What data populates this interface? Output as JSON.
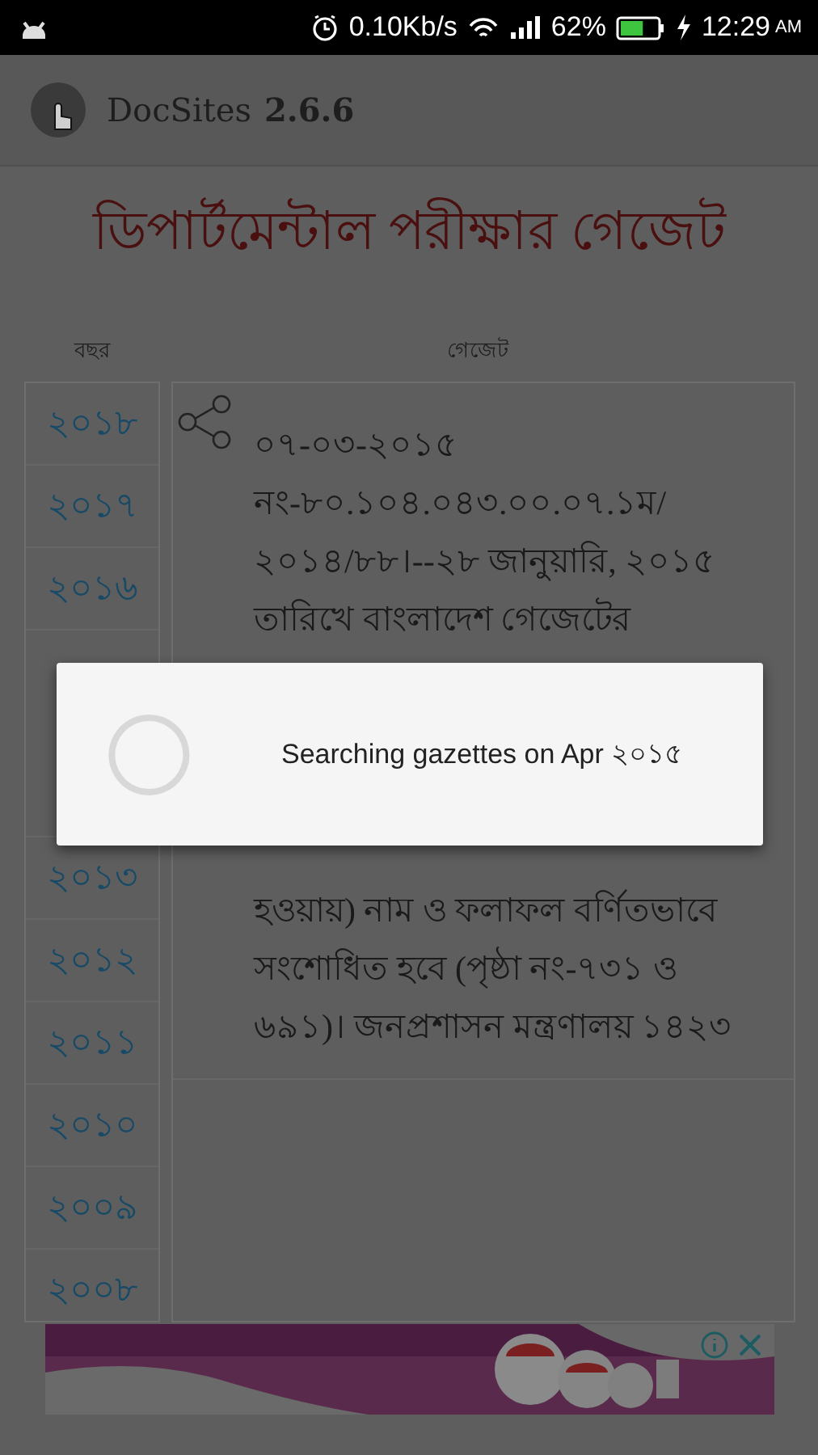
{
  "status_bar": {
    "network_speed": "0.10Kb/s",
    "battery": "62%",
    "time": "12:29",
    "meridiem": "AM"
  },
  "app_bar": {
    "title": "DocSites",
    "version": "2.6.6"
  },
  "page_title": "ডিপার্টমেন্টাল পরীক্ষার গেজেট",
  "columns": [
    "বছর",
    "গেজেট"
  ],
  "years": {
    "above": [
      "২০১৮",
      "২০১৭",
      "২০১৬"
    ],
    "below": [
      "২০১৩",
      "২০১২",
      "২০১১",
      "২০১০",
      "২০০৯",
      "২০০৮"
    ]
  },
  "gazette": {
    "lines_above": [
      "০৭-০৩-২০১৫",
      "নং-৮০.১০৪.০৪৩.০০.০৭.১ম/",
      "২০১৪/৮৮।--২৮ জানুয়ারি, ২০১৫",
      "তারিখে বাংলাদেশ গেজেটের"
    ],
    "lines_below": [
      "হওয়ায়) নাম ও ফলাফল বর্ণিতভাবে",
      "সংশোধিত হবে (পৃষ্ঠা নং-৭৩১ ও",
      "৬৯১)। জনপ্রশাসন মন্ত্রণালয় ১৪২৩"
    ]
  },
  "dialog": {
    "message": "Searching gazettes on Apr ২০১৫"
  }
}
